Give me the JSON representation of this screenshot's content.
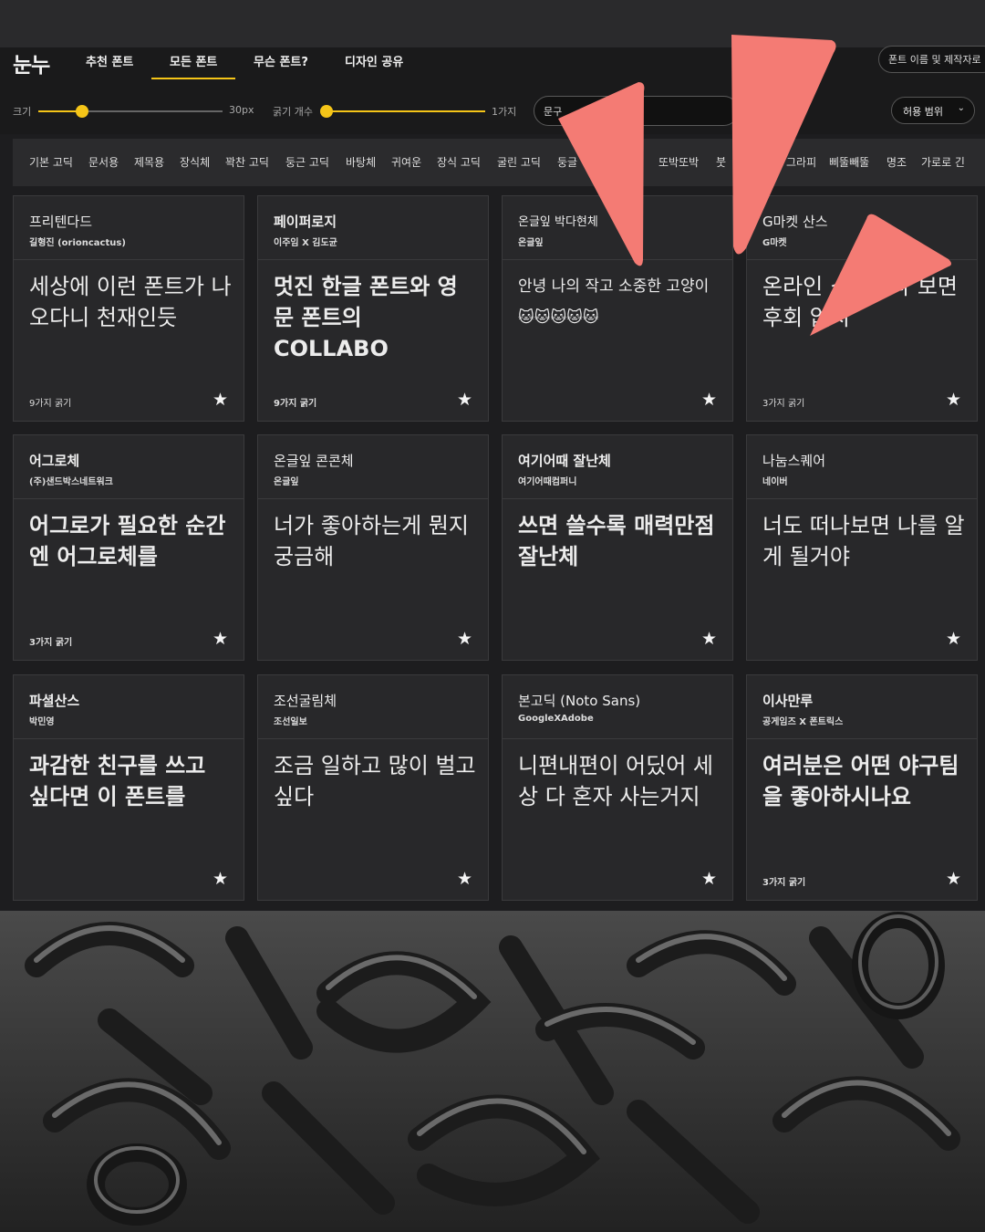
{
  "header": {
    "logo": "눈누",
    "nav": [
      "추천 폰트",
      "모든 폰트",
      "무슨 폰트?",
      "디자인 공유"
    ],
    "search_text": "폰트 이름 및 제작자로"
  },
  "controls": {
    "size_label": "크기",
    "size_value": "30px",
    "weight_label": "굵기 개수",
    "weight_value": "1가지",
    "text_input": "문구",
    "range_label": "허용 범위",
    "chevron_icon": "chevron-down-icon"
  },
  "categories": [
    "기본 고딕",
    "문서용",
    "제목용",
    "장식체",
    "꽉찬 고딕",
    "둥근 고딕",
    "바탕체",
    "귀여운",
    "장식 고딕",
    "굴린 고딕",
    "둥글",
    "또박또박",
    "붓",
    "그라피",
    "삐뚤빼뚤",
    "명조",
    "가로로 긴"
  ],
  "cards": [
    {
      "name": "프리텐다드",
      "author": "길형진 (orioncactus)",
      "sample": "세상에 이런 폰트가 나오다니 천재인듯",
      "weights": "9가지 굵기",
      "heavy": false
    },
    {
      "name": "페이퍼로지",
      "author": "이주임 X 김도균",
      "sample": "멋진 한글 폰트와 영문 폰트의 COLLABO",
      "weights": "9가지 굵기",
      "heavy": true
    },
    {
      "name": "온글잎 박다현체",
      "author": "온글잎",
      "sample": "안녕 나의 작고 소중한 고양이 🐱🐱🐱🐱🐱",
      "weights": "",
      "heavy": false
    },
    {
      "name": "G마켓 산스",
      "author": "G마켓",
      "sample": "온라인 쇼핑이다 보면 후회 없지",
      "weights": "3가지 굵기",
      "heavy": false
    },
    {
      "name": "어그로체",
      "author": "(주)샌드박스네트워크",
      "sample": "어그로가 필요한 순간엔 어그로체를",
      "weights": "3가지 굵기",
      "heavy": true
    },
    {
      "name": "온글잎 콘콘체",
      "author": "온글잎",
      "sample": "너가 좋아하는게 뭔지 궁금해",
      "weights": "",
      "heavy": false
    },
    {
      "name": "여기어때 잘난체",
      "author": "여기어때컴퍼니",
      "sample": "쓰면 쓸수록 매력만점 잘난체",
      "weights": "",
      "heavy": true
    },
    {
      "name": "나눔스퀘어",
      "author": "네이버",
      "sample": "너도 떠나보면 나를 알게 될거야",
      "weights": "",
      "heavy": false
    },
    {
      "name": "파셜산스",
      "author": "박민영",
      "sample": "과감한 친구를 쓰고 싶다면 이 폰트를",
      "weights": "",
      "heavy": true
    },
    {
      "name": "조선굴림체",
      "author": "조선일보",
      "sample": "조금 일하고 많이 벌고 싶다",
      "weights": "",
      "heavy": false
    },
    {
      "name": "본고딕 (Noto Sans)",
      "author": "GoogleXAdobe",
      "sample": "니편내편이 어딨어 세상 다 혼자 사는거지",
      "weights": "",
      "heavy": false
    },
    {
      "name": "이사만루",
      "author": "공게임즈 X 폰트릭스",
      "sample": "여러분은 어떤 야구팀을 좋아하시나요",
      "weights": "3가지 굵기",
      "heavy": true
    }
  ],
  "icons": {
    "star": "star-icon"
  },
  "colors": {
    "accent": "#f5c518",
    "arrow": "#f47b74",
    "background": "#1d1d1f",
    "card": "#28282a"
  }
}
